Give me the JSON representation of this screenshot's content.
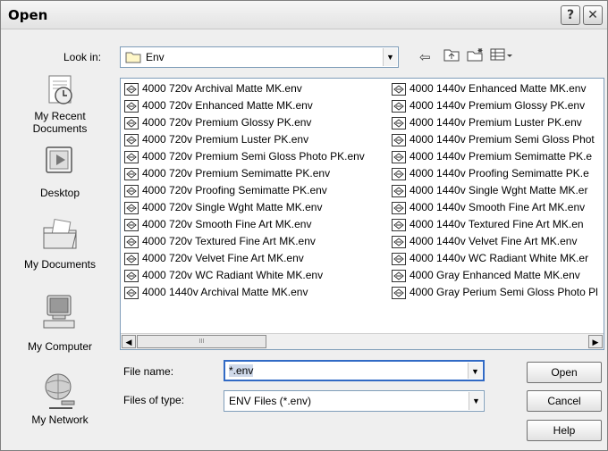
{
  "window": {
    "title": "Open"
  },
  "lookin": {
    "label": "Look in:",
    "value": "Env"
  },
  "places": [
    {
      "label": "My Recent Documents"
    },
    {
      "label": "Desktop"
    },
    {
      "label": "My Documents"
    },
    {
      "label": "My Computer"
    },
    {
      "label": "My Network"
    }
  ],
  "files_left": [
    "4000 720v Archival Matte MK.env",
    "4000 720v Enhanced Matte MK.env",
    "4000 720v Premium Glossy PK.env",
    "4000 720v Premium Luster PK.env",
    "4000 720v Premium Semi Gloss Photo PK.env",
    "4000 720v Premium Semimatte PK.env",
    "4000 720v Proofing Semimatte PK.env",
    "4000 720v Single Wght Matte MK.env",
    "4000 720v Smooth Fine Art MK.env",
    "4000 720v Textured Fine Art MK.env",
    "4000 720v Velvet Fine Art MK.env",
    "4000 720v WC Radiant White MK.env",
    "4000 1440v Archival Matte MK.env"
  ],
  "files_right": [
    "4000 1440v Enhanced Matte MK.env",
    "4000 1440v Premium Glossy PK.env",
    "4000 1440v Premium Luster PK.env",
    "4000 1440v Premium Semi Gloss Phot",
    "4000 1440v Premium Semimatte PK.e",
    "4000 1440v Proofing Semimatte PK.e",
    "4000 1440v Single Wght Matte MK.er",
    "4000 1440v Smooth Fine Art MK.env",
    "4000 1440v Textured Fine Art MK.en",
    "4000 1440v Velvet Fine Art MK.env",
    "4000 1440v WC Radiant White MK.er",
    "4000 Gray Enhanced Matte MK.env",
    "4000 Gray Perium Semi Gloss Photo Pl"
  ],
  "scrollbar": {
    "thumb_grip": "III"
  },
  "filename": {
    "label": "File name:",
    "value": "*.env"
  },
  "filetype": {
    "label": "Files of type:",
    "value": "ENV Files (*.env)"
  },
  "buttons": {
    "open": "Open",
    "cancel": "Cancel",
    "help": "Help"
  },
  "titlebar_buttons": {
    "help": "?",
    "close": "✕"
  },
  "colors": {
    "accent_border": "#7f9db9",
    "selection_border": "#316ac5"
  },
  "icons": [
    "folder-icon",
    "back-arrow-icon",
    "up-folder-icon",
    "new-folder-icon",
    "views-menu-icon",
    "env-file-icon"
  ]
}
